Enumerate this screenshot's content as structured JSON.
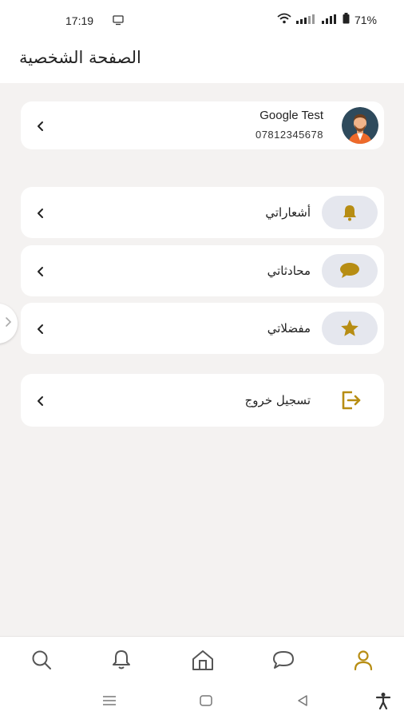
{
  "status_bar": {
    "time": "17:19",
    "battery": "71%",
    "media_icon": "cast-icon"
  },
  "app_bar": {
    "title": "الصفحة الشخصية"
  },
  "profile": {
    "name": "Google Test",
    "phone": "07812345678",
    "avatar_icon": "avatar-man-icon"
  },
  "menu": {
    "notifications_label": "أشعاراتي",
    "chats_label": "محادثاتي",
    "favorites_label": "مفضلاتي",
    "logout_label": "تسجيل خروج"
  },
  "colors": {
    "accent": "#b78d13",
    "icon_bg": "#e5e7ee",
    "page_bg": "#f4f2f1",
    "nav_icon": "#555555"
  },
  "bottom_nav": [
    "search-icon",
    "bell-icon",
    "home-icon",
    "chat-icon",
    "profile-icon"
  ],
  "system_nav": [
    "recents-icon",
    "home-square-icon",
    "back-icon",
    "accessibility-icon"
  ]
}
